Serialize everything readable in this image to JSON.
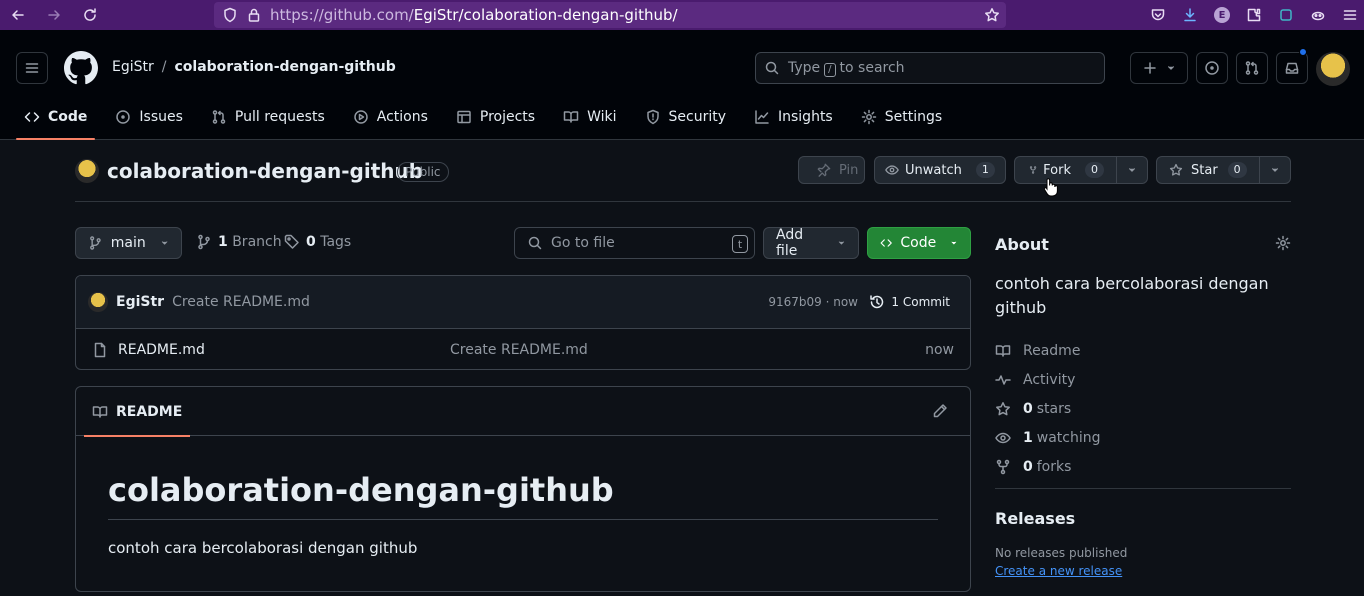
{
  "browser": {
    "url_prefix": "https://github.com/",
    "url_path": "EgiStr/colaboration-dengan-github/"
  },
  "header": {
    "owner": "EgiStr",
    "separator": "/",
    "repo": "colaboration-dengan-github",
    "search_pre": "Type",
    "search_key": "/",
    "search_post": "to search"
  },
  "tabs": [
    {
      "label": "Code"
    },
    {
      "label": "Issues"
    },
    {
      "label": "Pull requests"
    },
    {
      "label": "Actions"
    },
    {
      "label": "Projects"
    },
    {
      "label": "Wiki"
    },
    {
      "label": "Security"
    },
    {
      "label": "Insights"
    },
    {
      "label": "Settings"
    }
  ],
  "repo": {
    "title": "colaboration-dengan-github",
    "visibility": "Public",
    "pin_label": "Pin",
    "watch_label": "Unwatch",
    "watch_count": "1",
    "fork_label": "Fork",
    "fork_count": "0",
    "star_label": "Star",
    "star_count": "0"
  },
  "filenav": {
    "branch": "main",
    "branch_count": "1",
    "branch_label": "Branch",
    "tag_count": "0",
    "tag_label": "Tags",
    "goto_placeholder": "Go to file",
    "goto_key": "t",
    "add_file": "Add file",
    "code": "Code"
  },
  "commit": {
    "author": "EgiStr",
    "message": "Create README.md",
    "sha_age": "9167b09 · now",
    "commits": "1 Commit"
  },
  "files": [
    {
      "name": "README.md",
      "message": "Create README.md",
      "age": "now"
    }
  ],
  "readme": {
    "tab": "README",
    "heading": "colaboration-dengan-github",
    "body": "contoh cara bercolaborasi dengan github"
  },
  "about": {
    "title": "About",
    "description": "contoh cara bercolaborasi dengan github",
    "readme": "Readme",
    "activity": "Activity",
    "stars_count": "0",
    "stars_label": "stars",
    "watching_count": "1",
    "watching_label": "watching",
    "forks_count": "0",
    "forks_label": "forks"
  },
  "releases": {
    "title": "Releases",
    "none": "No releases published",
    "create": "Create a new release"
  },
  "colors": {
    "background": "#0d1117",
    "header": "#010409",
    "accent_tab": "#f78166",
    "green_button": "#238636",
    "link": "#4493f8",
    "browser_chrome": "#4a1b6e"
  }
}
